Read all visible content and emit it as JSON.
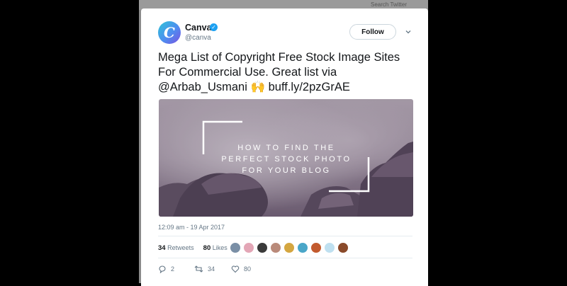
{
  "background": {
    "strip_text": "Search Twitter"
  },
  "tweet": {
    "author_name": "Canva",
    "author_handle": "@canva",
    "avatar_letter": "C",
    "verified": true,
    "follow_label": "Follow",
    "text_line1": "Mega List of Copyright Free Stock Image Sites",
    "text_line2": "For Commercial Use. Great list via",
    "text_line3_mention": "@Arbab_Usmani",
    "text_line3_emoji": "🙌",
    "text_line3_link": "buff.ly/2pzGrAE",
    "timestamp": "12:09 am - 19 Apr 2017",
    "retweets_count": "34",
    "retweets_label": "Retweets",
    "likes_count": "80",
    "likes_label": "Likes"
  },
  "media": {
    "headline_line1": "HOW TO FIND THE",
    "headline_line2": "PERFECT STOCK PHOTO",
    "headline_line3": "FOR YOUR BLOG"
  },
  "actions": {
    "reply_count": "2",
    "retweet_count": "34",
    "like_count": "80"
  },
  "colors": {
    "accent": "#1da1f2",
    "text": "#14171a",
    "muted": "#657786",
    "overlay_purple": "#5a4a66"
  },
  "icons": [
    "verified-badge-icon",
    "chevron-down-icon",
    "reply-icon",
    "retweet-icon",
    "heart-icon"
  ]
}
